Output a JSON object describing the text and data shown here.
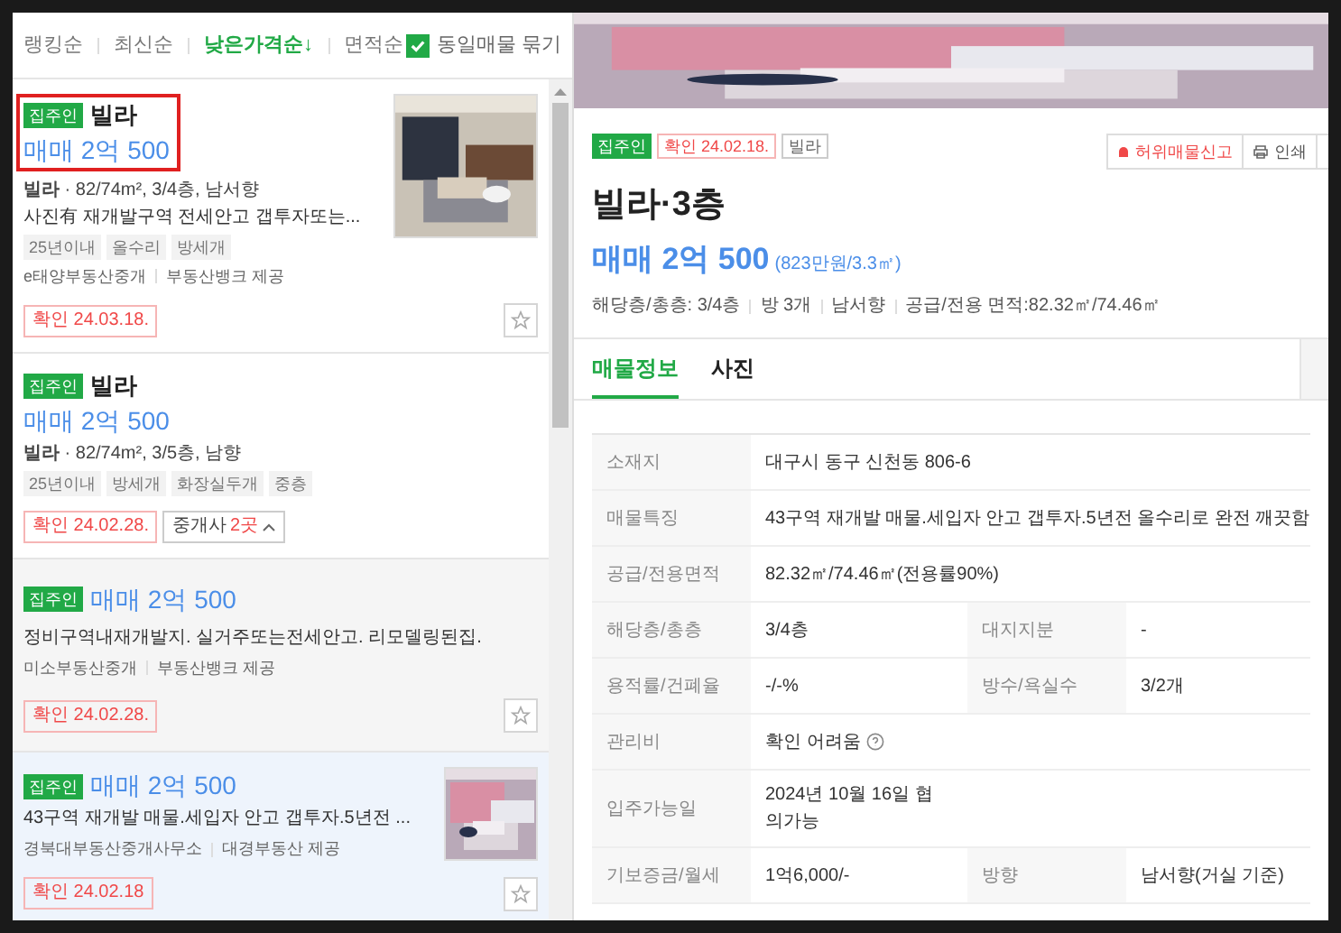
{
  "sort_bar": {
    "options": [
      {
        "label": "랭킹순",
        "selected": false
      },
      {
        "label": "최신순",
        "selected": false
      },
      {
        "label": "낮은가격순↓",
        "selected": true
      },
      {
        "label": "면적순",
        "selected": false
      }
    ],
    "group_same": {
      "label": "동일매물 묶기",
      "checked": true
    }
  },
  "listings": [
    {
      "badge": "집주인",
      "title": "빌라",
      "price": "매매 2억 500",
      "summary": "**빌라** · 82/74m², 3/4층, 남서향",
      "description": "사진有 재개발구역 전세안고 갭투자또는...",
      "tags": [
        "25년이내",
        "올수리",
        "방세개"
      ],
      "agent": "e태양부동산중개",
      "provider": "부동산뱅크 제공",
      "confirmed": "확인 24.03.18.",
      "highlighted": true,
      "has_photo": true,
      "selected": false
    },
    {
      "badge": "집주인",
      "title": "빌라",
      "price": "매매 2억 500",
      "summary": "**빌라** · 82/74m², 3/5층, 남향",
      "tags": [
        "25년이내",
        "방세개",
        "화장실두개",
        "중층"
      ],
      "confirmed": "확인 24.02.28.",
      "agents_button": {
        "label": "중개사",
        "count": "2곳",
        "expanded": true
      },
      "highlighted": false,
      "has_photo": false,
      "selected": false,
      "sub_listings": [
        {
          "badge": "집주인",
          "price": "매매 2억 500",
          "description": "정비구역내재개발지. 실거주또는전세안고. 리모델링된집.",
          "agent": "미소부동산중개",
          "provider": "부동산뱅크 제공",
          "confirmed": "확인 24.02.28."
        }
      ]
    },
    {
      "badge": "집주인",
      "price": "매매 2억 500",
      "description": "43구역 재개발 매물.세입자 안고 갭투자.5년전 ...",
      "agent": "경북대부동산중개사무소",
      "provider": "대경부동산 제공",
      "confirmed": "확인 24.02.18",
      "highlighted": false,
      "has_photo": true,
      "selected": true
    }
  ],
  "detail": {
    "badges": [
      "집주인",
      "확인 24.02.18.",
      "빌라"
    ],
    "actions": [
      "허위매물신고",
      "인쇄"
    ],
    "title": "빌라·3층",
    "price": "매매 2억 500",
    "unit_price": "(823만원/3.3㎡)",
    "facts": [
      "해당층/총층: 3/4층",
      "방 3개",
      "남서향",
      "공급/전용 면적:82.32㎡/74.46㎡"
    ],
    "tabs": [
      {
        "label": "매물정보",
        "selected": true
      },
      {
        "label": "사진",
        "selected": false
      }
    ],
    "info_rows": [
      {
        "cells": [
          {
            "label": "소재지",
            "value": "대구시 동구 신천동 806-6"
          }
        ]
      },
      {
        "cells": [
          {
            "label": "매물특징",
            "value": "43구역 재개발 매물.세입자 안고 갭투자.5년전 올수리로 완전 깨끗함"
          }
        ]
      },
      {
        "cells": [
          {
            "label": "공급/전용면적",
            "value": "82.32㎡/74.46㎡(전용률90%)"
          }
        ]
      },
      {
        "cells": [
          {
            "label": "해당층/총층",
            "value": "3/4층"
          },
          {
            "label": "대지지분",
            "value": "-"
          }
        ]
      },
      {
        "cells": [
          {
            "label": "용적률/건폐율",
            "value": "-/-%"
          },
          {
            "label": "방수/욕실수",
            "value": "3/2개"
          }
        ]
      },
      {
        "cells": [
          {
            "label": "관리비",
            "value": "확인 어려움",
            "help": true
          }
        ]
      },
      {
        "cells": [
          {
            "label": "입주가능일",
            "value": "2024년 10월 16일 협\n의가능"
          }
        ]
      },
      {
        "cells": [
          {
            "label": "기보증금/월세",
            "value": "1억6,000/-"
          },
          {
            "label": "방향",
            "value": "남서향(거실 기준)"
          }
        ]
      }
    ]
  }
}
